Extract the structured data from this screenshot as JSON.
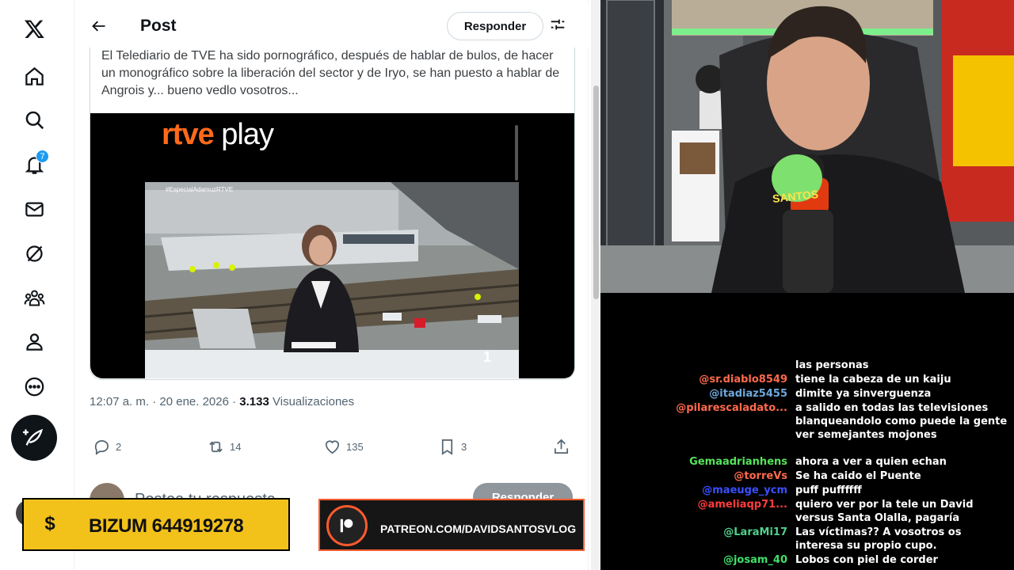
{
  "x": {
    "nav": [
      {
        "icon": "x-logo-icon"
      },
      {
        "icon": "home-icon"
      },
      {
        "icon": "search-icon"
      },
      {
        "icon": "notifications-icon"
      },
      {
        "icon": "messages-icon"
      },
      {
        "icon": "grok-icon"
      },
      {
        "icon": "communities-icon"
      },
      {
        "icon": "profile-icon"
      },
      {
        "icon": "more-icon"
      }
    ],
    "notification_count": "7",
    "header": {
      "title": "Post",
      "reply_label": "Responder"
    },
    "quote_text": "El Telediario de TVE ha sido pornográfico, después de hablar de bulos, de hacer un monográfico sobre la liberación del sector y de Iryo, se han puesto a hablar de Angrois y... bueno vedlo vosotros...",
    "video": {
      "logo_prefix": "rtve",
      "logo_suffix": " play",
      "hashtag": "#EspecialAdamuzRTVE",
      "counter": "1"
    },
    "meta": {
      "time": "12:07 a. m. · 20 ene. 2026 · ",
      "views_count": "3.133",
      "views_label": " Visualizaciones"
    },
    "actions": {
      "replies": "2",
      "reposts": "14",
      "likes": "135",
      "bookmarks": "3"
    },
    "reply_box": {
      "placeholder": "Postea tu respuesta",
      "button": "Responder"
    }
  },
  "overlay": {
    "bizum_icon": "$",
    "bizum": "BIZUM 644919278",
    "patreon": "PATREON.COM/DAVIDSANTOSVLOG"
  },
  "webcam": {
    "mic_brand": "SANTOS"
  },
  "chat": [
    {
      "user": "",
      "msg": "las personas",
      "color": "#ffffff"
    },
    {
      "user": "@sr.diablo8549",
      "msg": "tiene la cabeza de un kaiju",
      "color": "#ff6a4d"
    },
    {
      "user": "@itadiaz5455",
      "msg": "dimite ya sinverguenza",
      "color": "#6fa8dc"
    },
    {
      "user": "@pilarescaladato...",
      "msg": "a salido en todas las televisiones blanqueandolo como puede la gente ver semejantes mojones",
      "color": "#ff6a4d"
    },
    {
      "user": "Gemaadrianhens",
      "msg": "ahora a ver a quien echan",
      "color": "#57e35b"
    },
    {
      "user": "@torreVs",
      "msg": "Se ha caido el Puente",
      "color": "#ff6a4d"
    },
    {
      "user": "@maeuge_ycm",
      "msg": "puff puffffff",
      "color": "#3b50ff"
    },
    {
      "user": "@ameliaqp71...",
      "msg": "quiero ver por la tele un David versus Santa Olalla, pagaría",
      "color": "#ff3b3b"
    },
    {
      "user": "@LaraMi17",
      "msg": "Las víctimas?? A vosotros os interesa su propio cupo.",
      "color": "#4fd18b"
    },
    {
      "user": "@josam_40",
      "msg": "Lobos con piel de corder",
      "color": "#3fe06a"
    }
  ]
}
